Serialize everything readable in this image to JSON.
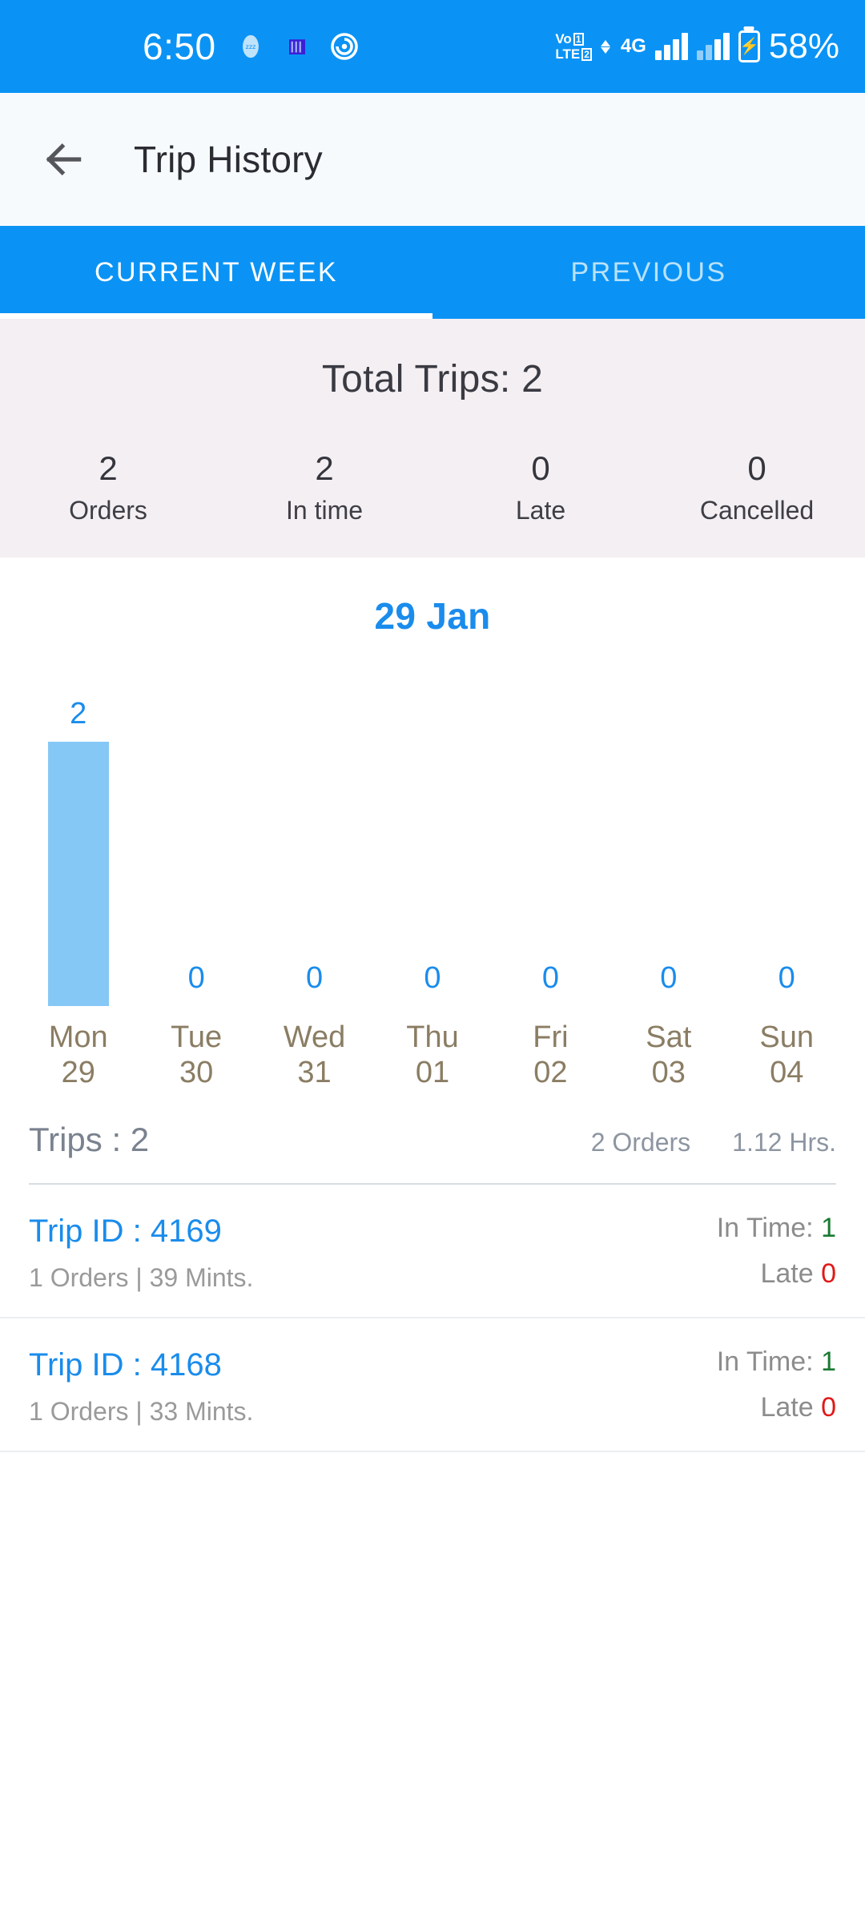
{
  "status_bar": {
    "time": "6:50",
    "volte_label_top": "Vo",
    "volte_label_bottom": "LTE",
    "volte_sim1": "1",
    "volte_sim2": "2",
    "network": "4G",
    "battery_percent": "58%",
    "icons": [
      "clock",
      "sleep-mode-icon",
      "app-notification-icon",
      "spiral-app-icon",
      "volte-icon",
      "signal-4g-icon",
      "signal-bars-icon",
      "battery-charging-icon"
    ]
  },
  "appbar": {
    "back_icon": "back-arrow-icon",
    "title": "Trip History"
  },
  "tabs": {
    "items": [
      {
        "label": "CURRENT WEEK",
        "active": true
      },
      {
        "label": "PREVIOUS",
        "active": false
      }
    ]
  },
  "summary": {
    "title": "Total Trips: 2",
    "stats": [
      {
        "value": "2",
        "label": "Orders"
      },
      {
        "value": "2",
        "label": "In time"
      },
      {
        "value": "0",
        "label": "Late"
      },
      {
        "value": "0",
        "label": "Cancelled"
      }
    ]
  },
  "chart_data": {
    "type": "bar",
    "title": "29 Jan",
    "categories": [
      "Mon",
      "Tue",
      "Wed",
      "Thu",
      "Fri",
      "Sat",
      "Sun"
    ],
    "category_dates": [
      "29",
      "30",
      "31",
      "01",
      "02",
      "03",
      "04"
    ],
    "values": [
      2,
      0,
      0,
      0,
      0,
      0,
      0
    ],
    "value_labels": [
      "2",
      "0",
      "0",
      "0",
      "0",
      "0",
      "0"
    ],
    "xlabel": "",
    "ylabel": "",
    "ylim": [
      0,
      2
    ],
    "grid": false,
    "legend": "none",
    "bar_color": "#85c8f5",
    "label_color": "#1a8cec",
    "tick_color": "#8a7d63"
  },
  "trips_header": {
    "title": "Trips : 2",
    "orders": "2 Orders",
    "duration": "1.12 Hrs."
  },
  "trips": [
    {
      "id_label": "Trip ID  : 4169",
      "sub": "1 Orders | 39 Mints.",
      "in_time_label": "In Time:",
      "in_time_value": "1",
      "late_label": "Late",
      "late_value": "0"
    },
    {
      "id_label": "Trip ID  : 4168",
      "sub": "1 Orders | 33 Mints.",
      "in_time_label": "In Time:",
      "in_time_value": "1",
      "late_label": "Late",
      "late_value": "0"
    }
  ],
  "colors": {
    "primary": "#0a93f5",
    "accent_blue": "#1a8cec",
    "bar": "#85c8f5",
    "summary_bg": "#f4eff2",
    "success": "#1a7a32",
    "danger": "#e01919"
  }
}
